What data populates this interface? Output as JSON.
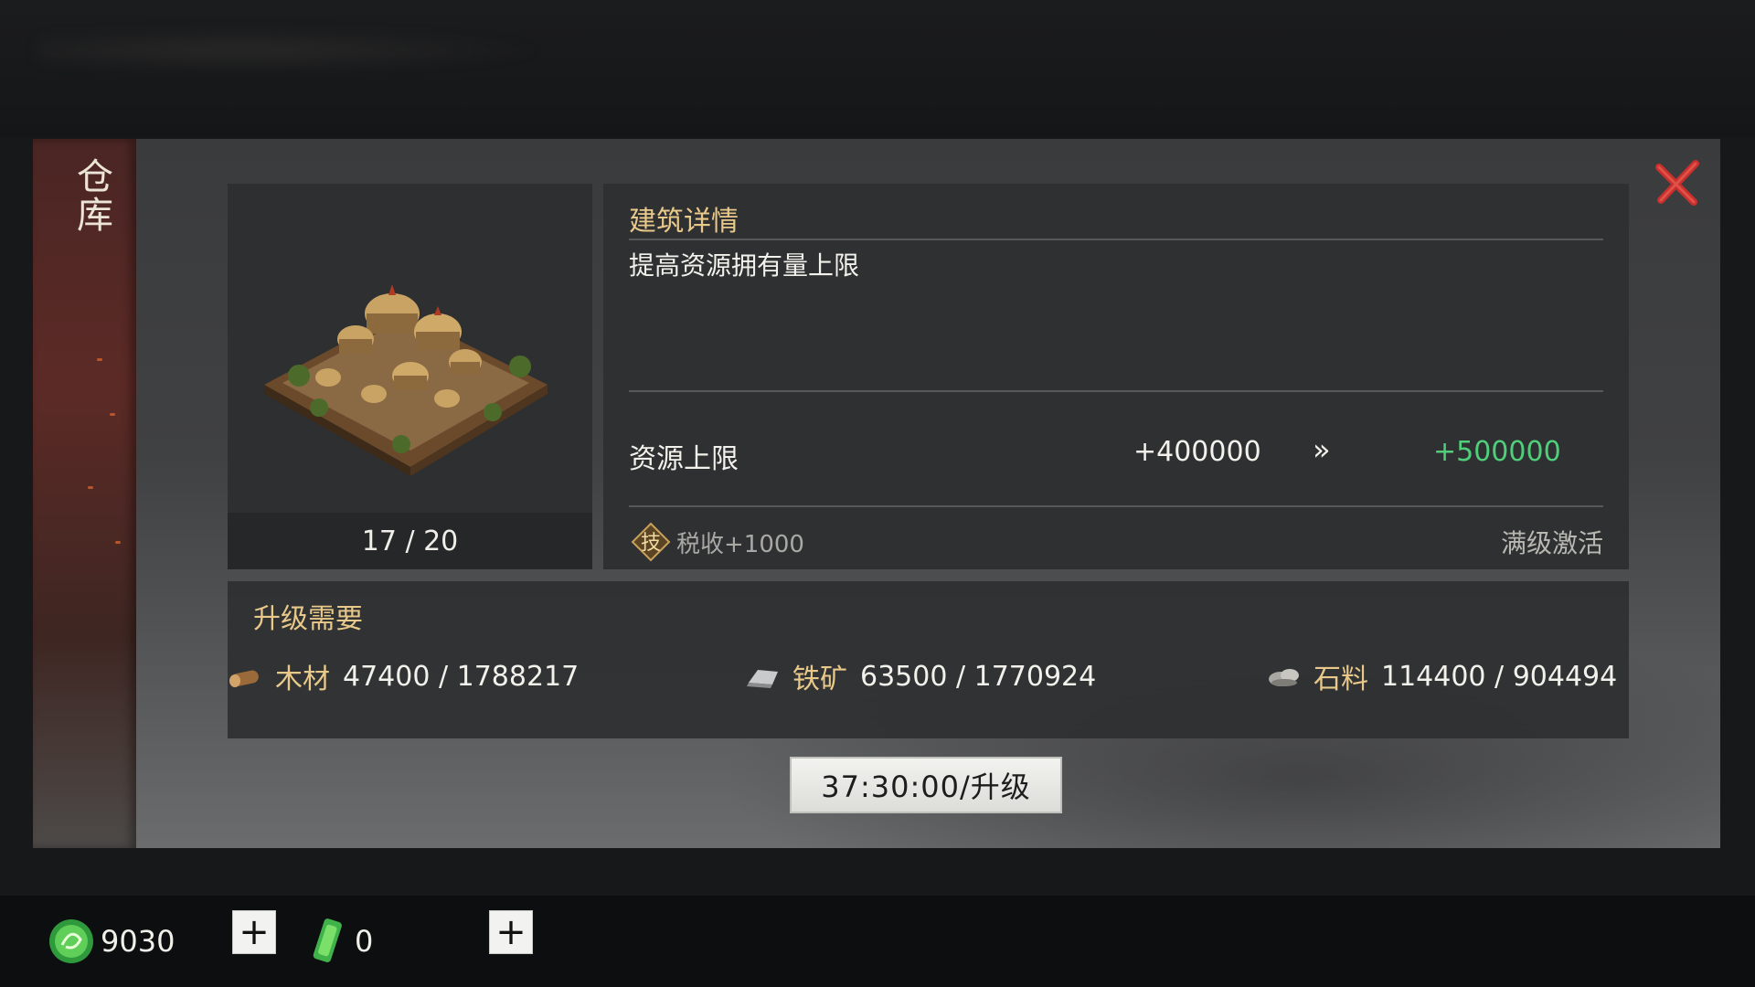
{
  "side_title": "仓库",
  "building": {
    "level": "17 / 20"
  },
  "details": {
    "title": "建筑详情",
    "description": "提高资源拥有量上限",
    "stat_label": "资源上限",
    "stat_current": "+400000",
    "stat_arrow": "»",
    "stat_next": "+500000",
    "skill_badge": "技",
    "skill_text": "税收+1000",
    "max_level_note": "满级激活"
  },
  "requirements": {
    "title": "升级需要",
    "items": [
      {
        "icon": "wood-icon",
        "name": "木材",
        "value": "47400 / 1788217"
      },
      {
        "icon": "iron-icon",
        "name": "铁矿",
        "value": "63500 / 1770924"
      },
      {
        "icon": "stone-icon",
        "name": "石料",
        "value": "114400 / 904494"
      }
    ]
  },
  "upgrade_button": "37:30:00/升级",
  "bottom_bar": {
    "jade_amount": "9030",
    "token_amount": "0",
    "plus_label": "+"
  },
  "colors": {
    "accent_gold": "#e9c98a",
    "next_value_green": "#4fcf7a",
    "close_red": "#c8302c"
  }
}
